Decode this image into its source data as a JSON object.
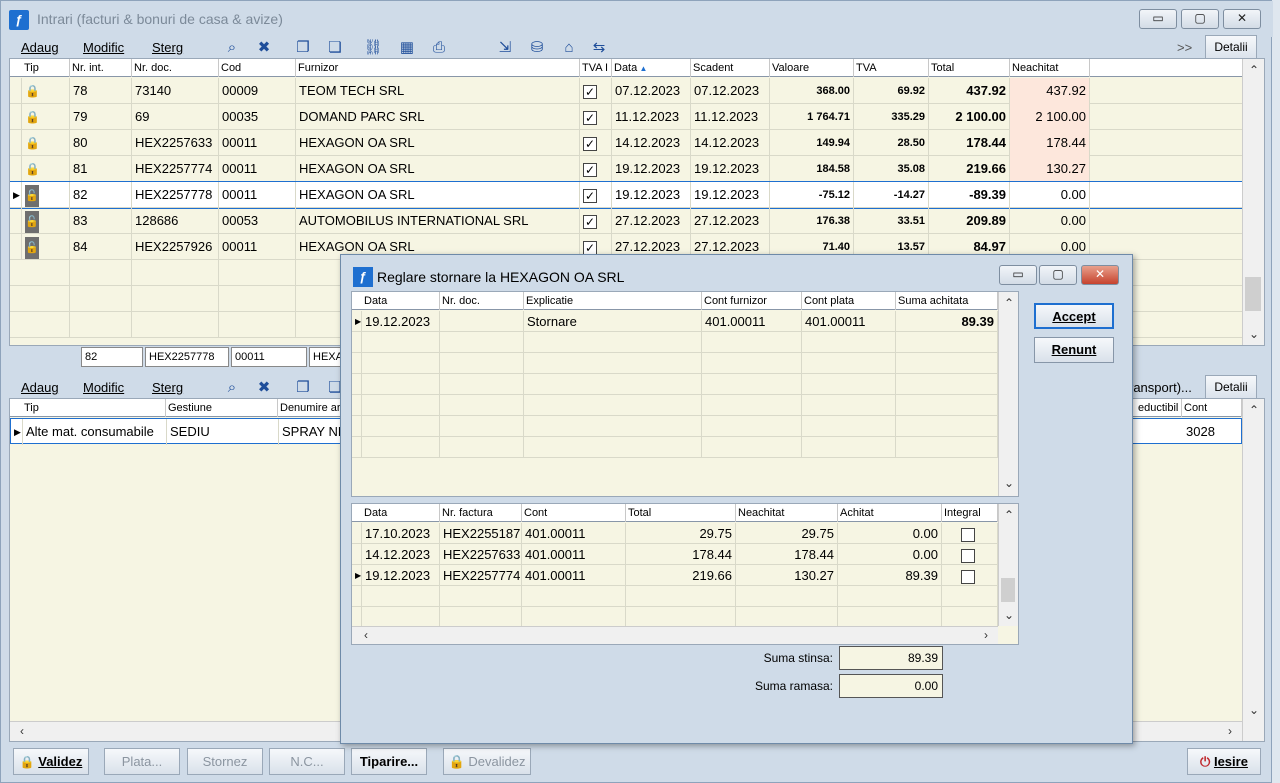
{
  "window": {
    "title": "Intrari (facturi & bonuri de casa & avize)",
    "minimize": "▭",
    "maximize": "▢",
    "close": "✕"
  },
  "toolbar_top": {
    "add": "Adaug",
    "modify": "Modific",
    "delete": "Sterg",
    "more": ">>",
    "details": "Detalii"
  },
  "invoices": {
    "columns": [
      "Tip",
      "Nr. int.",
      "Nr. doc.",
      "Cod",
      "Furnizor",
      "TVA I",
      "Data",
      "Scadent",
      "Valoare",
      "TVA",
      "Total",
      "Neachitat"
    ],
    "rows": [
      {
        "lock": "red",
        "nr_int": "78",
        "nr_doc": "73140",
        "cod": "00009",
        "furnizor": "TEOM TECH SRL",
        "tva_i": true,
        "data": "07.12.2023",
        "scadent": "07.12.2023",
        "valoare": "368.00",
        "tva": "69.92",
        "total": "437.92",
        "neachitat": "437.92"
      },
      {
        "lock": "red",
        "nr_int": "79",
        "nr_doc": "69",
        "cod": "00035",
        "furnizor": "DOMAND PARC SRL",
        "tva_i": true,
        "data": "11.12.2023",
        "scadent": "11.12.2023",
        "valoare": "1 764.71",
        "tva": "335.29",
        "total": "2 100.00",
        "neachitat": "2 100.00"
      },
      {
        "lock": "red",
        "nr_int": "80",
        "nr_doc": "HEX2257633",
        "cod": "00011",
        "furnizor": "HEXAGON OA SRL",
        "tva_i": true,
        "data": "14.12.2023",
        "scadent": "14.12.2023",
        "valoare": "149.94",
        "tva": "28.50",
        "total": "178.44",
        "neachitat": "178.44"
      },
      {
        "lock": "red",
        "nr_int": "81",
        "nr_doc": "HEX2257774",
        "cod": "00011",
        "furnizor": "HEXAGON OA SRL",
        "tva_i": true,
        "data": "19.12.2023",
        "scadent": "19.12.2023",
        "valoare": "184.58",
        "tva": "35.08",
        "total": "219.66",
        "neachitat": "130.27"
      },
      {
        "lock": "gray",
        "nr_int": "82",
        "nr_doc": "HEX2257778",
        "cod": "00011",
        "furnizor": "HEXAGON OA SRL",
        "tva_i": true,
        "data": "19.12.2023",
        "scadent": "19.12.2023",
        "valoare": "-75.12",
        "tva": "-14.27",
        "total": "-89.39",
        "neachitat": "0.00"
      },
      {
        "lock": "gray",
        "nr_int": "83",
        "nr_doc": "128686",
        "cod": "00053",
        "furnizor": "AUTOMOBILUS INTERNATIONAL SRL",
        "tva_i": true,
        "data": "27.12.2023",
        "scadent": "27.12.2023",
        "valoare": "176.38",
        "tva": "33.51",
        "total": "209.89",
        "neachitat": "0.00"
      },
      {
        "lock": "gray",
        "nr_int": "84",
        "nr_doc": "HEX2257926",
        "cod": "00011",
        "furnizor": "HEXAGON OA SRL",
        "tva_i": true,
        "data": "27.12.2023",
        "scadent": "27.12.2023",
        "valoare": "71.40",
        "tva": "13.57",
        "total": "84.97",
        "neachitat": "0.00"
      }
    ],
    "selected_index": 4
  },
  "filter_row": {
    "nr_int": "82",
    "nr_doc": "HEX2257778",
    "cod": "00011",
    "furnizor": "HEXA"
  },
  "toolbar_bottom": {
    "add": "Adaug",
    "modify": "Modific",
    "delete": "Sterg",
    "transport": "ransport)...",
    "details": "Detalii"
  },
  "lines": {
    "columns": [
      "Tip",
      "Gestiune",
      "Denumire ar",
      "eductibil",
      "Cont"
    ],
    "rows": [
      {
        "tip": "Alte mat. consumabile",
        "gestiune": "SEDIU",
        "denumire": "SPRAY NE",
        "cont": "3028"
      }
    ]
  },
  "buttons": {
    "validez": "Validez",
    "plata": "Plata...",
    "stornez": "Stornez",
    "nc": "N.C...",
    "tiparire": "Tiparire...",
    "devalidez": "Devalidez",
    "iesire": "Iesire"
  },
  "dialog": {
    "title": "Reglare stornare la HEXAGON OA SRL",
    "accept": "Accept",
    "renunt": "Renunt",
    "top_columns": [
      "Data",
      "Nr. doc.",
      "Explicatie",
      "Cont furnizor",
      "Cont plata",
      "Suma achitata"
    ],
    "top_rows": [
      {
        "data": "19.12.2023",
        "nr_doc": "",
        "explicatie": "Stornare",
        "cont_furnizor": "401.00011",
        "cont_plata": "401.00011",
        "suma": "89.39"
      }
    ],
    "bottom_columns": [
      "Data",
      "Nr. factura",
      "Cont",
      "Total",
      "Neachitat",
      "Achitat",
      "Integral"
    ],
    "bottom_rows": [
      {
        "data": "17.10.2023",
        "nr_factura": "HEX2255187",
        "cont": "401.00011",
        "total": "29.75",
        "neachitat": "29.75",
        "achitat": "0.00"
      },
      {
        "data": "14.12.2023",
        "nr_factura": "HEX2257633",
        "cont": "401.00011",
        "total": "178.44",
        "neachitat": "178.44",
        "achitat": "0.00"
      },
      {
        "data": "19.12.2023",
        "nr_factura": "HEX2257774",
        "cont": "401.00011",
        "total": "219.66",
        "neachitat": "130.27",
        "achitat": "89.39"
      }
    ],
    "suma_stinsa_label": "Suma stinsa:",
    "suma_stinsa": "89.39",
    "suma_ramasa_label": "Suma ramasa:",
    "suma_ramasa": "0.00"
  }
}
